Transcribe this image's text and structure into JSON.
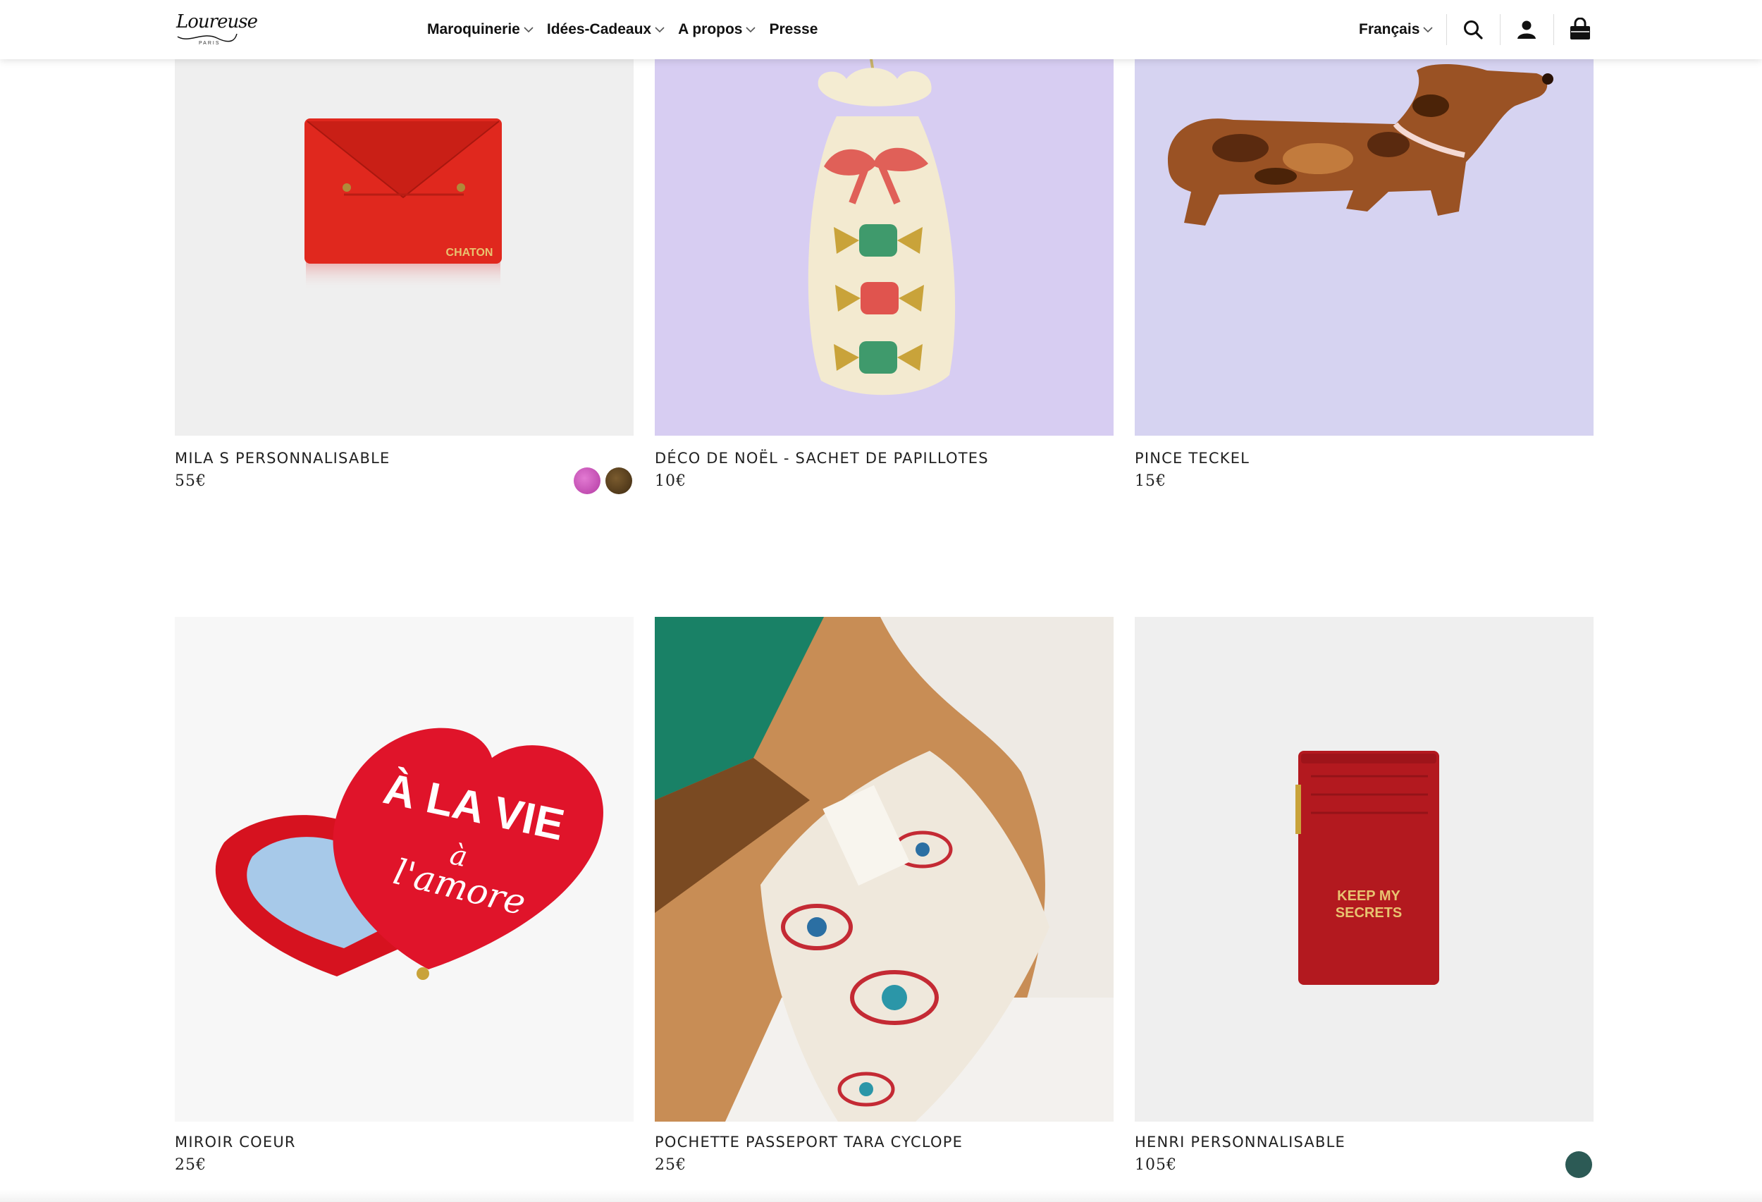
{
  "header": {
    "logo_text": "Loureuse",
    "logo_sub": "PARIS",
    "nav": [
      {
        "label": "Maroquinerie"
      },
      {
        "label": "Idées-Cadeaux"
      },
      {
        "label": "A propos"
      },
      {
        "label": "Presse"
      }
    ],
    "language": "Français",
    "icons": [
      "search-icon",
      "account-icon",
      "cart-icon"
    ]
  },
  "products": [
    {
      "name": "MILA S PERSONNALISABLE",
      "price": "55€",
      "image_text": "CHATON",
      "swatches": [
        "#c74ab7",
        "#5a3f1e"
      ]
    },
    {
      "name": "DÉCO DE NOËL - SACHET DE PAPILLOTES",
      "price": "10€"
    },
    {
      "name": "PINCE TECKEL",
      "price": "15€"
    },
    {
      "name": "MIROIR COEUR",
      "price": "25€",
      "image_text_1": "À LA VIE",
      "image_text_2": "à",
      "image_text_3": "l'amore"
    },
    {
      "name": "POCHETTE PASSEPORT TARA CYCLOPE",
      "price": "25€"
    },
    {
      "name": "HENRI PERSONNALISABLE",
      "price": "105€",
      "image_text_1": "KEEP MY",
      "image_text_2": "SECRETS",
      "swatches": [
        "#2c5a55"
      ]
    }
  ]
}
